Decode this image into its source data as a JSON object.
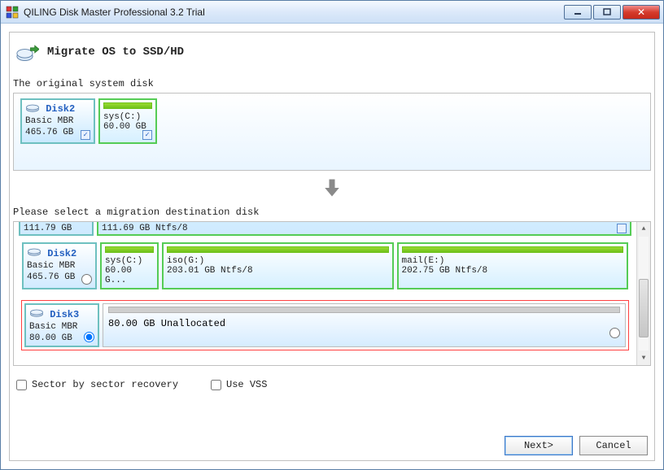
{
  "window": {
    "title": "QILING Disk Master Professional 3.2 Trial"
  },
  "header": {
    "title": "Migrate OS to SSD/HD"
  },
  "labels": {
    "original": "The original system disk",
    "destination": "Please select a migration destination disk"
  },
  "source": {
    "disk": {
      "name": "Disk2",
      "type": "Basic MBR",
      "size": "465.76 GB"
    },
    "partition": {
      "name": "sys(C:)",
      "size": "60.00 GB"
    }
  },
  "cutoff": {
    "diskSize": "111.79 GB",
    "partInfo": "111.69 GB Ntfs/8"
  },
  "dest": {
    "disk2": {
      "name": "Disk2",
      "type": "Basic MBR",
      "size": "465.76 GB",
      "parts": [
        {
          "name": "sys(C:)",
          "size": "60.00 G..."
        },
        {
          "name": "iso(G:)",
          "size": "203.01 GB Ntfs/8"
        },
        {
          "name": "mail(E:)",
          "size": "202.75 GB Ntfs/8"
        }
      ]
    },
    "disk3": {
      "name": "Disk3",
      "type": "Basic MBR",
      "size": "80.00 GB",
      "unalloc": "80.00 GB Unallocated"
    }
  },
  "options": {
    "sector": "Sector by sector recovery",
    "vss": "Use VSS"
  },
  "buttons": {
    "next": "Next>",
    "cancel": "Cancel"
  }
}
